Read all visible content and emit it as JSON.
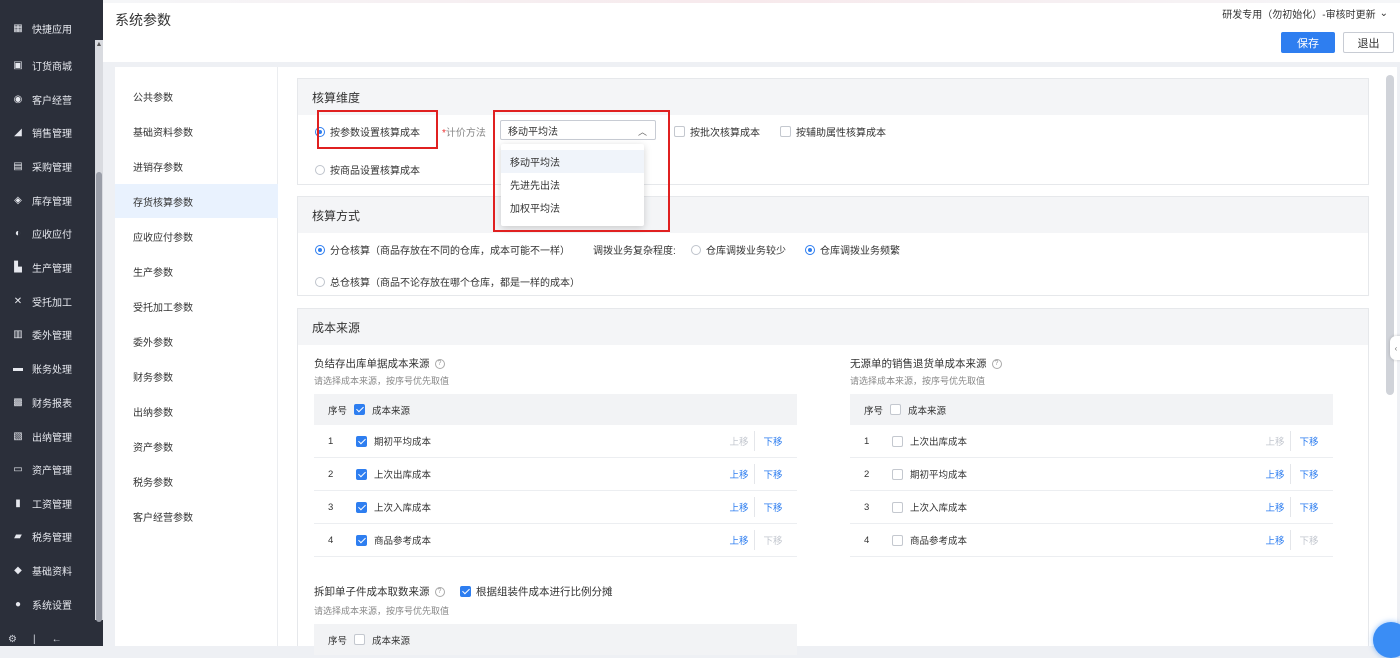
{
  "nav": {
    "items": [
      {
        "label": "快捷应用",
        "icon": "apps-grid-icon"
      },
      {
        "label": "订货商城",
        "icon": "shop-bag-icon"
      },
      {
        "label": "客户经营",
        "icon": "customer-icon"
      },
      {
        "label": "销售管理",
        "icon": "sales-chart-icon"
      },
      {
        "label": "采购管理",
        "icon": "cart-icon"
      },
      {
        "label": "库存管理",
        "icon": "box-icon"
      },
      {
        "label": "应收应付",
        "icon": "receivable-icon"
      },
      {
        "label": "生产管理",
        "icon": "factory-icon"
      },
      {
        "label": "受托加工",
        "icon": "tools-icon"
      },
      {
        "label": "委外管理",
        "icon": "outsource-icon"
      },
      {
        "label": "账务处理",
        "icon": "ledger-icon"
      },
      {
        "label": "财务报表",
        "icon": "report-icon"
      },
      {
        "label": "出纳管理",
        "icon": "cashier-icon"
      },
      {
        "label": "资产管理",
        "icon": "asset-icon"
      },
      {
        "label": "工资管理",
        "icon": "salary-icon"
      },
      {
        "label": "税务管理",
        "icon": "tax-icon"
      },
      {
        "label": "基础资料",
        "icon": "layers-icon"
      },
      {
        "label": "系统设置",
        "icon": "settings-icon"
      }
    ]
  },
  "header": {
    "title": "系统参数",
    "account": "研发专用（勿初始化）-审核时更新",
    "save": "保存",
    "exit": "退出"
  },
  "menu": {
    "items": [
      "公共参数",
      "基础资料参数",
      "进销存参数",
      "存货核算参数",
      "应收应付参数",
      "生产参数",
      "受托加工参数",
      "委外参数",
      "财务参数",
      "出纳参数",
      "资产参数",
      "税务参数",
      "客户经营参数"
    ],
    "active_index": 3
  },
  "dimension": {
    "title": "核算维度",
    "opt_param": "按参数设置核算成本",
    "method_label": "计价方法",
    "method_required": "*",
    "method_value": "移动平均法",
    "options": [
      "移动平均法",
      "先进先出法",
      "加权平均法"
    ],
    "by_batch": "按批次核算成本",
    "by_aux": "按辅助属性核算成本",
    "opt_goods": "按商品设置核算成本"
  },
  "method": {
    "title": "核算方式",
    "by_warehouse": "分仓核算（商品存放在不同的仓库，成本可能不一样）",
    "transfer_label": "调拨业务复杂程度:",
    "transfer_few": "仓库调拨业务较少",
    "transfer_many": "仓库调拨业务频繁",
    "total": "总仓核算（商品不论存放在哪个仓库，都是一样的成本）"
  },
  "cost_source": {
    "title": "成本来源",
    "left": {
      "title": "负结存出库单据成本来源",
      "hint": "请选择成本来源，按序号优先取值",
      "col_idx": "序号",
      "col_src": "成本来源",
      "rows": [
        {
          "idx": "1",
          "name": "期初平均成本",
          "up": "上移",
          "down": "下移"
        },
        {
          "idx": "2",
          "name": "上次出库成本",
          "up": "上移",
          "down": "下移"
        },
        {
          "idx": "3",
          "name": "上次入库成本",
          "up": "上移",
          "down": "下移"
        },
        {
          "idx": "4",
          "name": "商品参考成本",
          "up": "上移",
          "down": "下移"
        }
      ]
    },
    "right": {
      "title": "无源单的销售退货单成本来源",
      "hint": "请选择成本来源，按序号优先取值",
      "col_idx": "序号",
      "col_src": "成本来源",
      "rows": [
        {
          "idx": "1",
          "name": "上次出库成本",
          "up": "上移",
          "down": "下移"
        },
        {
          "idx": "2",
          "name": "期初平均成本",
          "up": "上移",
          "down": "下移"
        },
        {
          "idx": "3",
          "name": "上次入库成本",
          "up": "上移",
          "down": "下移"
        },
        {
          "idx": "4",
          "name": "商品参考成本",
          "up": "上移",
          "down": "下移"
        }
      ]
    },
    "split": {
      "title": "拆卸单子件成本取数来源",
      "checkbox": "根据组装件成本进行比例分摊",
      "hint": "请选择成本来源，按序号优先取值",
      "col_idx": "序号",
      "col_src": "成本来源"
    }
  },
  "colors": {
    "accent": "#2e7ef0",
    "nav_bg": "#2b2f3a",
    "highlight_red": "#e02020"
  }
}
